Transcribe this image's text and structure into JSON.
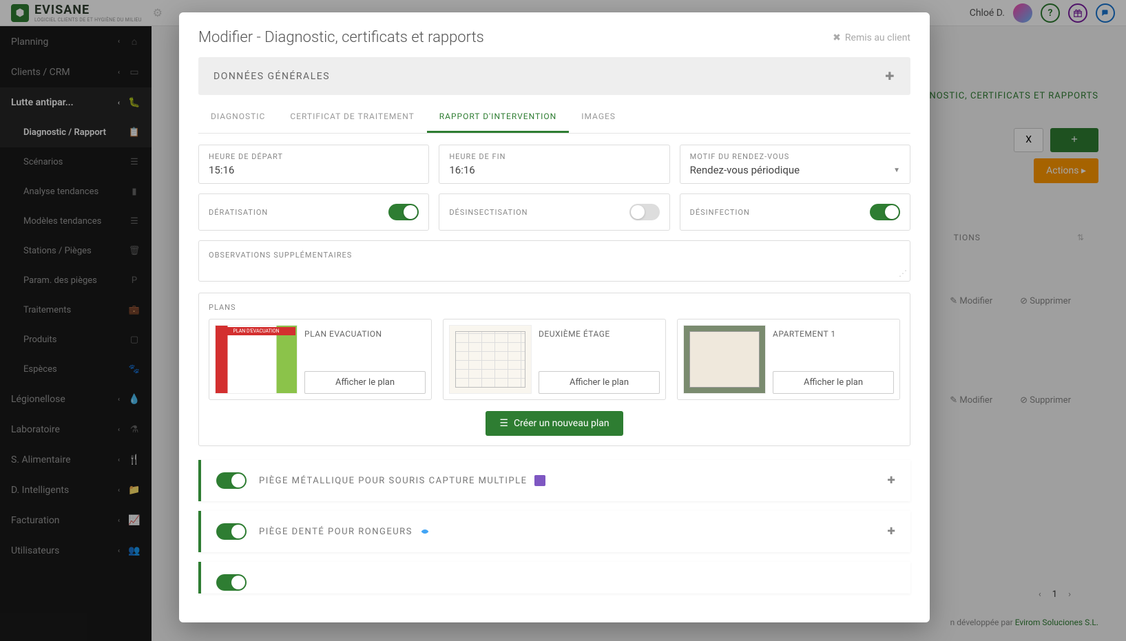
{
  "topbar": {
    "brand": "EVISANE",
    "brand_sub": "LOGICIEL CLIENTS DE ET HYGIÈNE DU MILIEU",
    "user": "Chloé D."
  },
  "sidebar": {
    "items": [
      {
        "label": "Planning",
        "icon": "home"
      },
      {
        "label": "Clients / CRM",
        "icon": "card"
      },
      {
        "label": "Lutte antipar...",
        "icon": "bug",
        "active": true
      },
      {
        "label": "Légionellose",
        "icon": "drop"
      },
      {
        "label": "Laboratoire",
        "icon": "flask"
      },
      {
        "label": "S. Alimentaire",
        "icon": "food"
      },
      {
        "label": "D. Intelligents",
        "icon": "folder"
      },
      {
        "label": "Facturation",
        "icon": "chart"
      },
      {
        "label": "Utilisateurs",
        "icon": "users"
      }
    ],
    "subs": [
      {
        "label": "Diagnostic / Rapport",
        "icon": "clip",
        "active": true
      },
      {
        "label": "Scénarios",
        "icon": "list"
      },
      {
        "label": "Analyse tendances",
        "icon": "bar"
      },
      {
        "label": "Modèles tendances",
        "icon": "list"
      },
      {
        "label": "Stations / Pièges",
        "icon": "trash"
      },
      {
        "label": "Param. des pièges",
        "icon": "P"
      },
      {
        "label": "Traitements",
        "icon": "brief"
      },
      {
        "label": "Produits",
        "icon": "box"
      },
      {
        "label": "Espèces",
        "icon": "paw"
      }
    ]
  },
  "content_bg": {
    "breadcrumb": "AGNOSTIC, CERTIFICATS ET RAPPORTS",
    "x_btn": "X",
    "actions_btn": "Actions",
    "tions_header": "TIONS",
    "modifier": "Modifier",
    "supprimer": "Supprimer",
    "page": "1",
    "footer_text": "n développée par ",
    "footer_link": "Evirom Soluciones S.L."
  },
  "modal": {
    "title": "Modifier - Diagnostic, certificats et rapports",
    "remis": "Remis au client",
    "panel_general": "DONNÉES GÉNÉRALES",
    "tabs": {
      "diagnostic": "DIAGNOSTIC",
      "certificat": "CERTIFICAT DE TRAITEMENT",
      "rapport": "RAPPORT D'INTERVENTION",
      "images": "IMAGES"
    },
    "fields": {
      "depart_label": "HEURE DE DÉPART",
      "depart_value": "15:16",
      "fin_label": "HEURE DE FIN",
      "fin_value": "16:16",
      "motif_label": "MOTIF DU RENDEZ-VOUS",
      "motif_value": "Rendez-vous périodique",
      "derat": "DÉRATISATION",
      "desinsect": "DÉSINSECTISATION",
      "desinfect": "DÉSINFECTION",
      "obs": "OBSERVATIONS SUPPLÉMENTAIRES",
      "plans": "PLANS"
    },
    "plans": [
      {
        "title": "PLAN EVACUATION",
        "btn": "Afficher le plan"
      },
      {
        "title": "DEUXIÈME ÉTAGE",
        "btn": "Afficher le plan"
      },
      {
        "title": "APARTEMENT 1",
        "btn": "Afficher le plan"
      }
    ],
    "create_plan": "Créer un nouveau plan",
    "traps": [
      {
        "label": "PIÈGE MÉTALLIQUE POUR SOURIS CAPTURE MULTIPLE",
        "icon_color": "#7e57c2"
      },
      {
        "label": "PIÈGE DENTÉ POUR RONGEURS",
        "icon_color": "#42a5f5"
      }
    ]
  }
}
